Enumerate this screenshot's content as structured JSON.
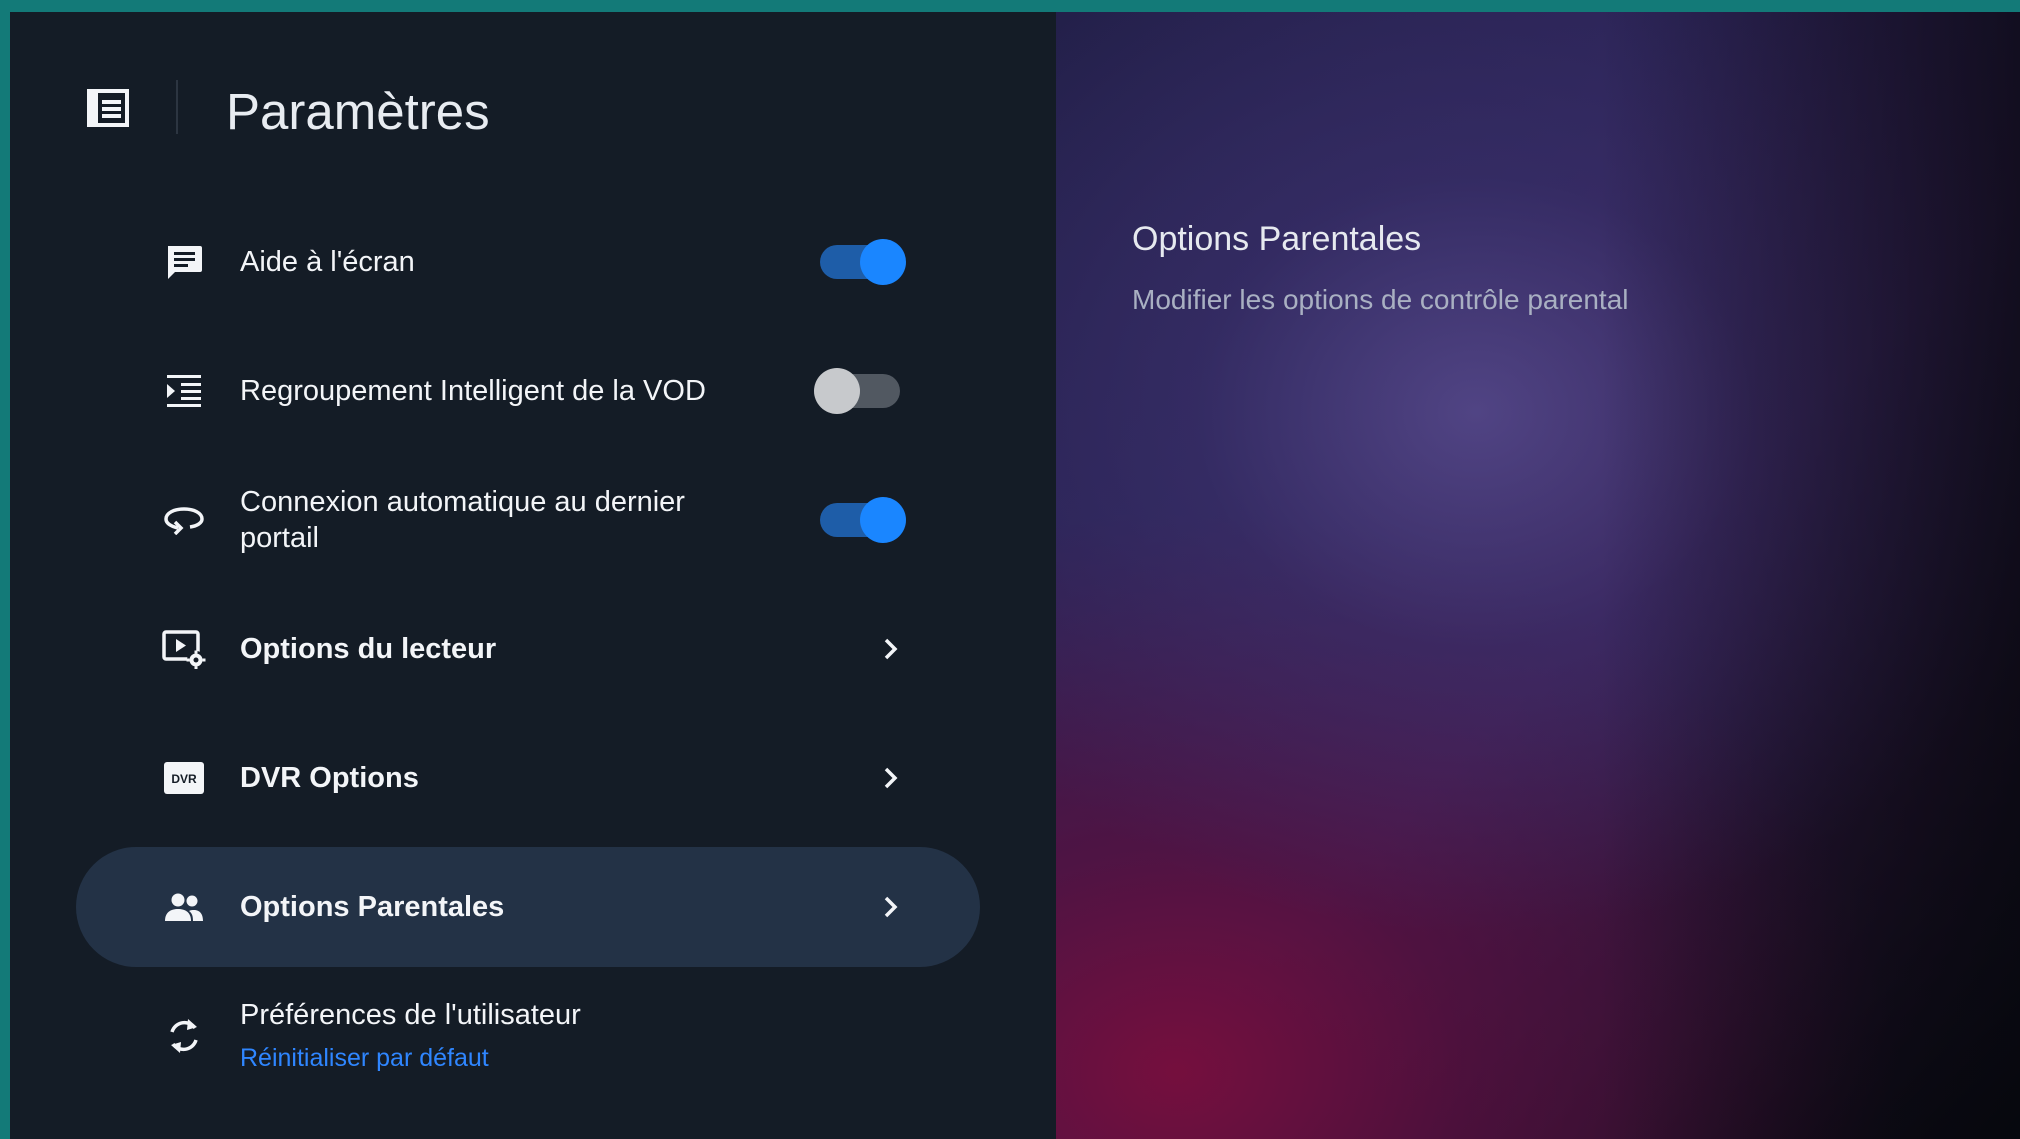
{
  "header": {
    "title": "Paramètres",
    "menu_icon": "menu-list-icon"
  },
  "settings": [
    {
      "label": "Aide à l'écran",
      "icon": "chat-bubble-icon",
      "control": "toggle",
      "toggle_on": true
    },
    {
      "label": "Regroupement Intelligent de la VOD",
      "icon": "indent-list-icon",
      "control": "toggle",
      "toggle_on": false
    },
    {
      "label": "Connexion automatique au dernier portail",
      "icon": "rotate-360-icon",
      "control": "toggle",
      "toggle_on": true
    },
    {
      "label": "Options du lecteur",
      "icon": "player-settings-icon",
      "control": "chevron"
    },
    {
      "label": "DVR Options",
      "icon": "dvr-icon",
      "control": "chevron"
    },
    {
      "label": "Options Parentales",
      "icon": "people-icon",
      "control": "chevron",
      "selected": true
    },
    {
      "label": "Préférences de l'utilisateur",
      "sublabel": "Réinitialiser par défaut",
      "icon": "sync-icon",
      "control": "none"
    }
  ],
  "detail": {
    "title": "Options Parentales",
    "description": "Modifier les options de contrôle parental"
  },
  "colors": {
    "frame": "#137a78",
    "panel_bg": "#141c26",
    "selected_row": "#233246",
    "accent_blue": "#1a86ff",
    "link_blue": "#2f86ff"
  }
}
